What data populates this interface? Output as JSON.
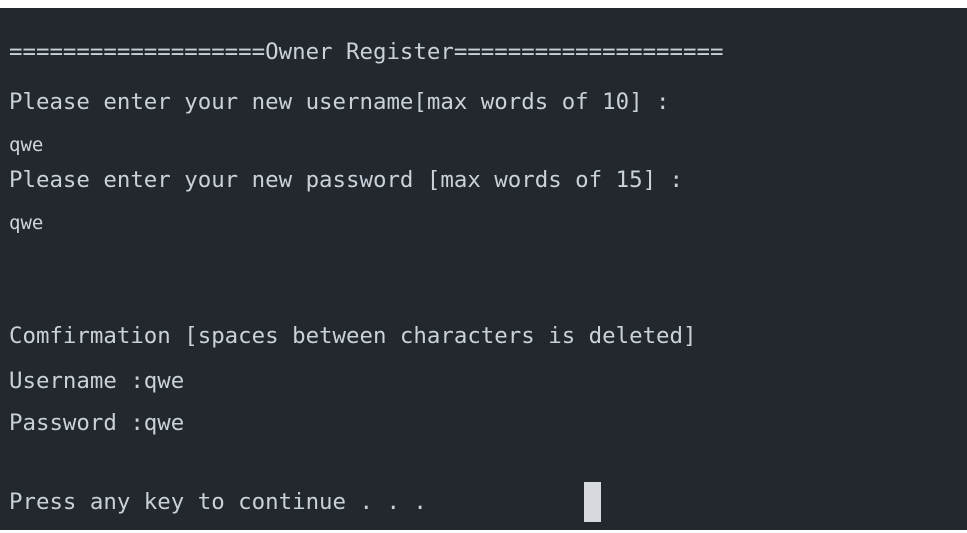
{
  "terminal": {
    "lines": [
      "===================Owner Register====================",
      "Please enter your new username[max words of 10] :",
      "qwe",
      "Please enter your new password [max words of 15] :",
      "qwe",
      "Comfirmation [spaces between characters is deleted]",
      "Username :qwe",
      "Password :qwe",
      "Press any key to continue . . ."
    ]
  },
  "colors": {
    "background": "#23272e",
    "text": "#c9d1d9",
    "cursor": "#d6d9de"
  }
}
